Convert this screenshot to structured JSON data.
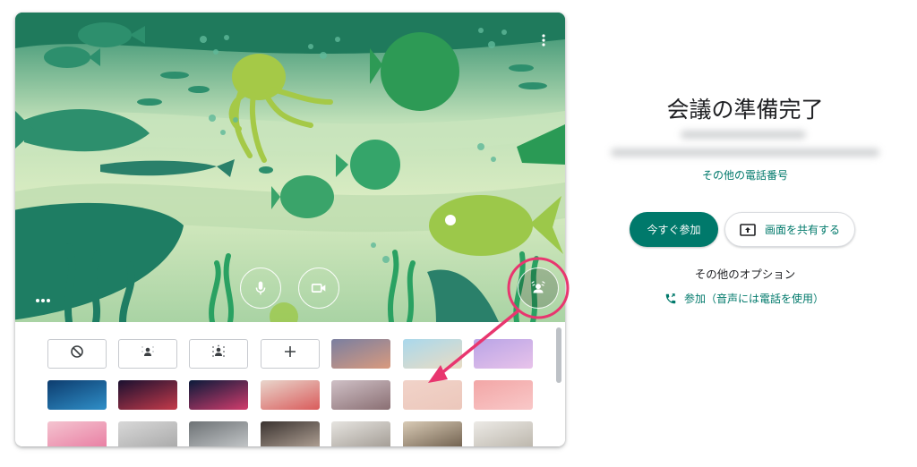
{
  "preview": {
    "more_icon": "more-vert-icon",
    "mic_icon": "microphone-icon",
    "camera_icon": "videocam-icon",
    "effects_icon": "background-effects-icon"
  },
  "background_panel": {
    "options": [
      {
        "name": "no-effect",
        "icon": "block-icon"
      },
      {
        "name": "slight-blur",
        "icon": "person-blur-icon"
      },
      {
        "name": "blur",
        "icon": "person-blur-strong-icon"
      },
      {
        "name": "upload",
        "icon": "plus-icon"
      }
    ],
    "image_colors": [
      [
        "#7a7fa0",
        "#d99a7e"
      ],
      [
        "#a9d8ec",
        "#e9dcc4"
      ],
      [
        "#b9a4e6",
        "#e8c3ea"
      ],
      [
        "#0d3c6e",
        "#2f8fc8"
      ],
      [
        "#1a1030",
        "#c53a4a"
      ],
      [
        "#0a1a3a",
        "#d23c6c"
      ],
      [
        "#e9d6cc",
        "#d95b5b"
      ],
      [
        "#cfc0c6",
        "#8a6f73"
      ],
      [
        "#f1d3c9",
        "#ecc7bb"
      ],
      [
        "#f2a6a6",
        "#f9c8c8"
      ],
      [
        "#f4c4d0",
        "#e87aa0"
      ],
      [
        "#d8d8d8",
        "#a7a7a7"
      ],
      [
        "#6d7275",
        "#c8cbcd"
      ],
      [
        "#3a3330",
        "#b7a79a"
      ],
      [
        "#e6e4e0",
        "#9f9890"
      ],
      [
        "#d9cbb6",
        "#6a5a48"
      ],
      [
        "#eceae6",
        "#b9b3a8"
      ],
      [
        "#1b2230",
        "#d9a35a"
      ]
    ]
  },
  "right": {
    "title": "会議の準備完了",
    "other_phone_numbers": "その他の電話番号",
    "join_now": "今すぐ参加",
    "share_screen": "画面を共有する",
    "share_icon": "present-to-all-icon",
    "other_options": "その他のオプション",
    "join_by_phone": "参加（音声には電話を使用）",
    "phone_icon": "phone-forwarded-icon"
  },
  "colors": {
    "accent": "#00796b",
    "annotation": "#e8366f"
  }
}
